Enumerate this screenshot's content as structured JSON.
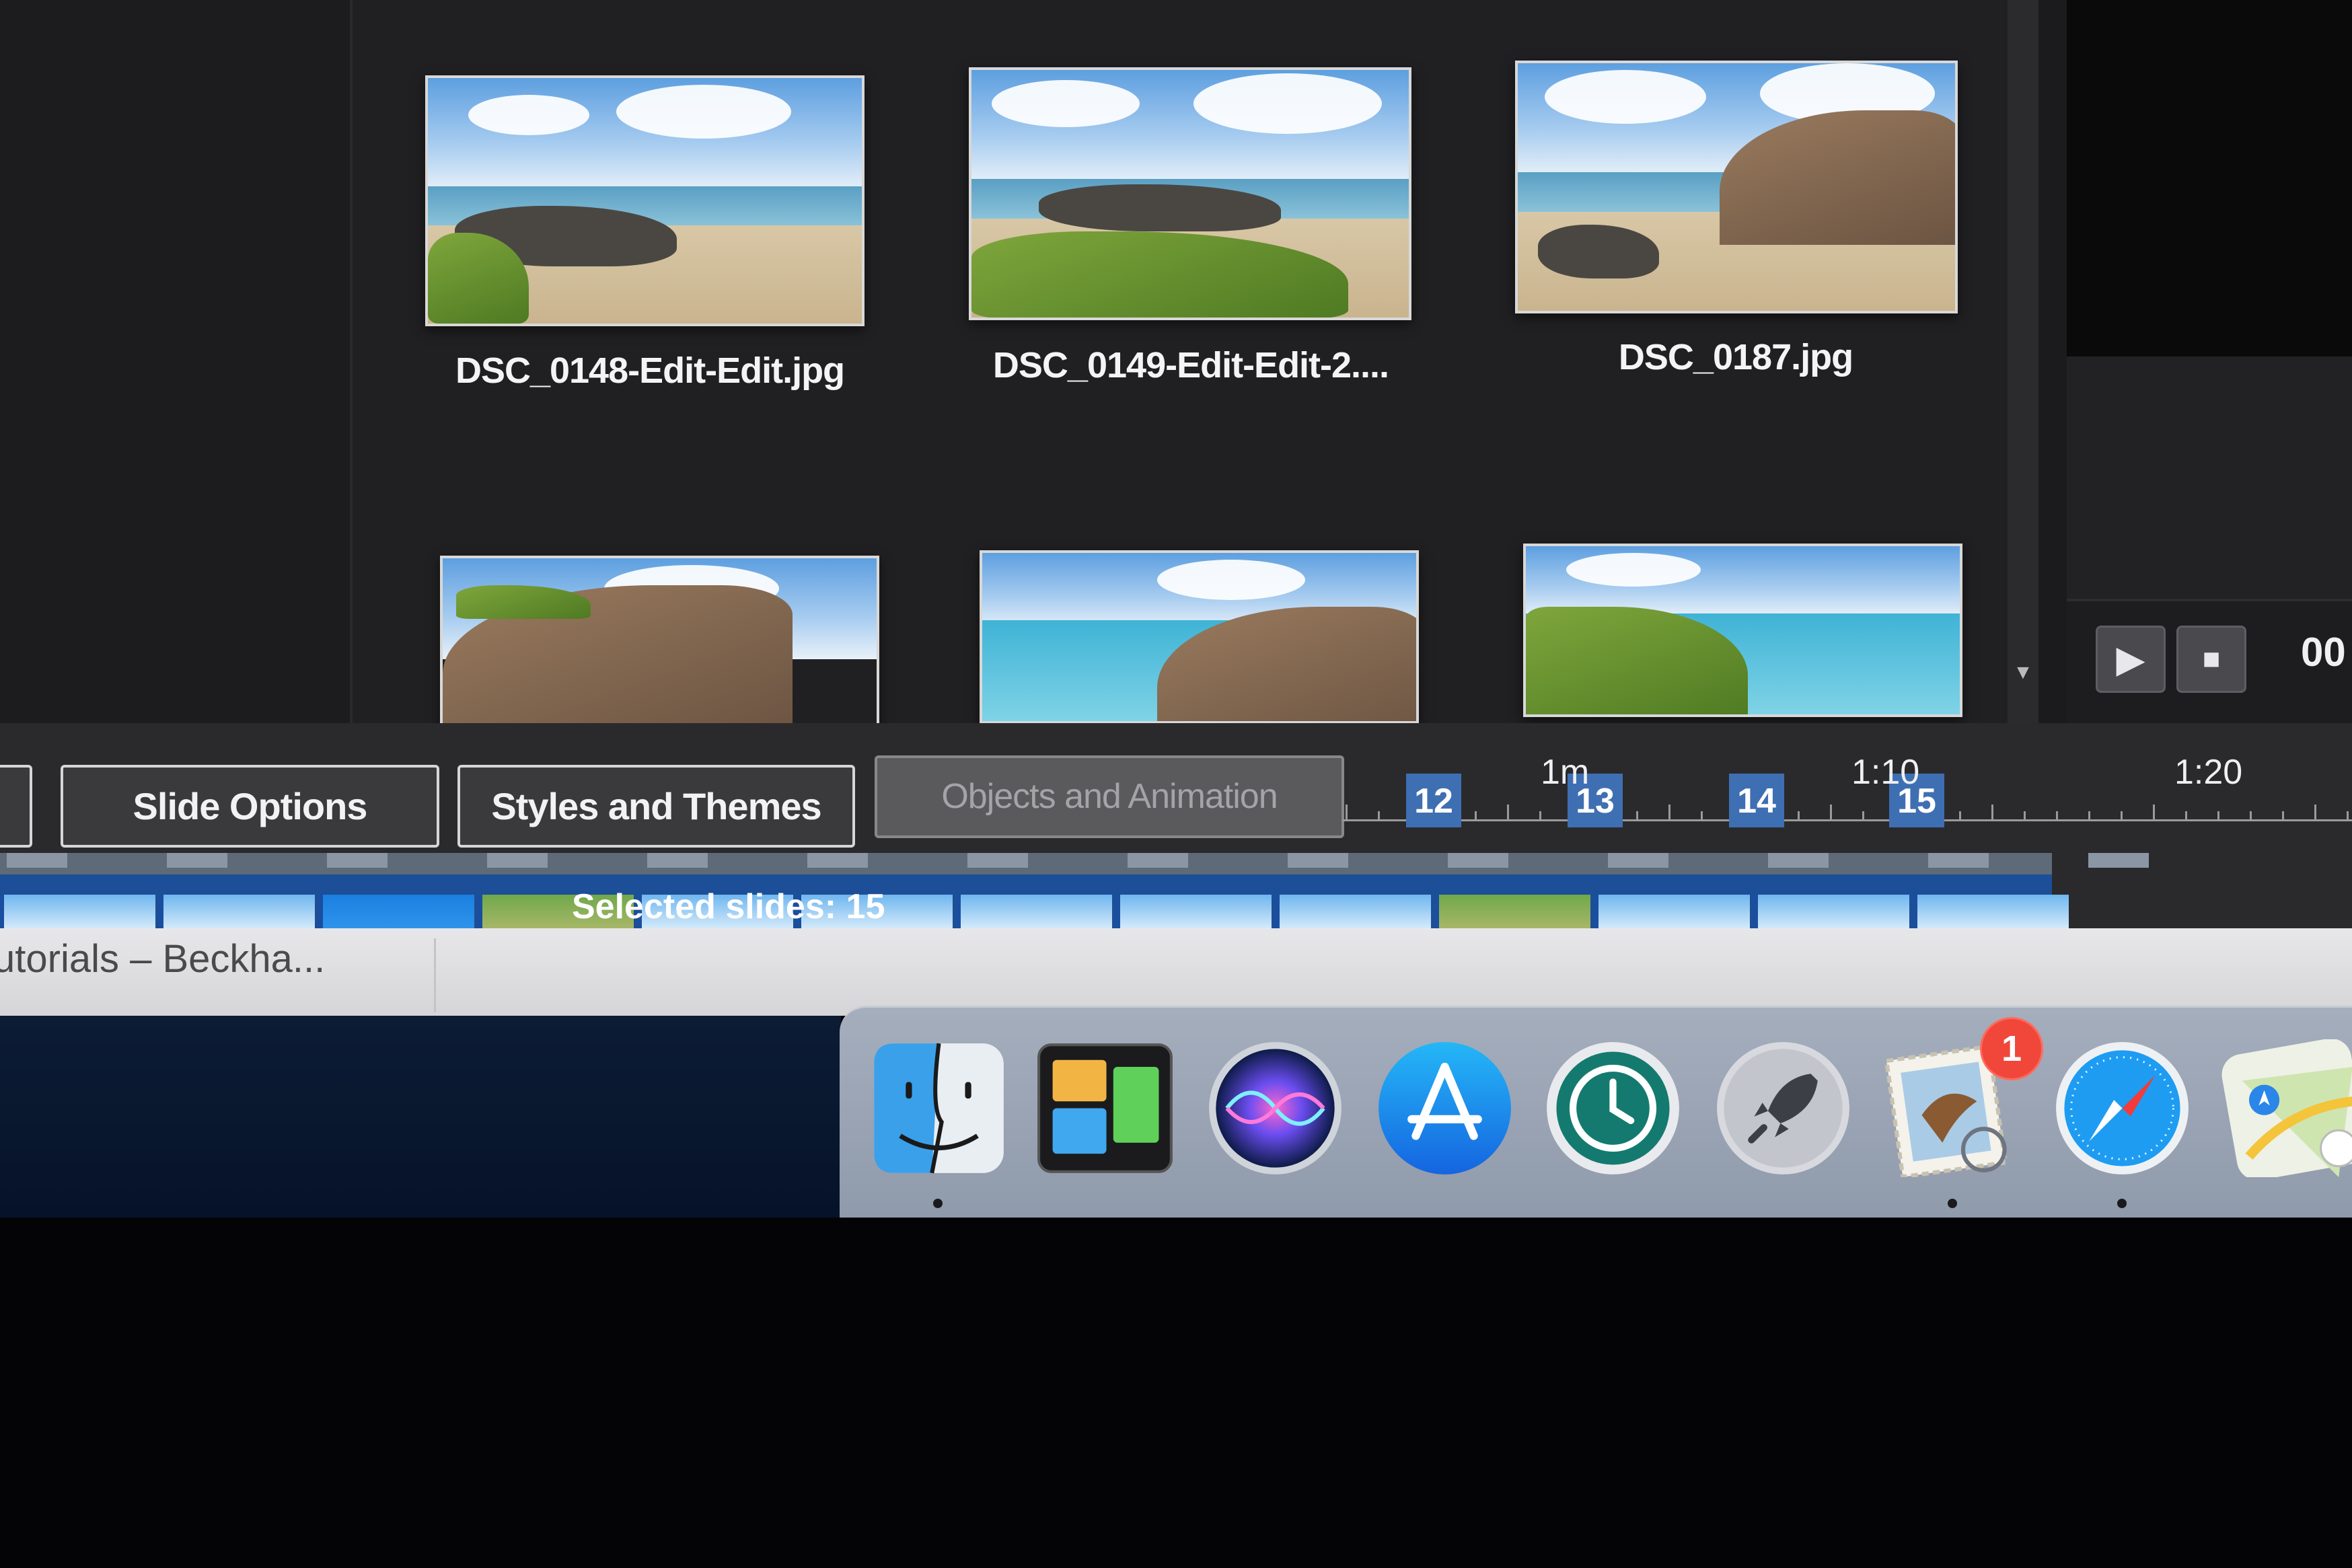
{
  "browser": {
    "photos": [
      {
        "filename": "DSC_0148-Edit-Edit.jpg"
      },
      {
        "filename": "DSC_0149-Edit-Edit-2...."
      },
      {
        "filename": "DSC_0187.jpg"
      },
      {
        "filename": ""
      },
      {
        "filename": ""
      },
      {
        "filename": ""
      }
    ]
  },
  "preview": {
    "time": "00",
    "play_icon": "play-icon",
    "stop_icon": "stop-icon"
  },
  "timeline": {
    "tabs": [
      {
        "label": "Slide Options"
      },
      {
        "label": "Styles and Themes"
      },
      {
        "label": "Objects and Animation"
      }
    ],
    "markers": [
      "12",
      "13",
      "14",
      "15"
    ],
    "time_labels": [
      "1m",
      "1:10",
      "1:20"
    ],
    "selected_slides": "Selected slides: 15"
  },
  "window": {
    "title": "utorials – Beckha..."
  },
  "dock": {
    "items": [
      "Finder",
      "Mission Control",
      "Siri",
      "App Store",
      "Time Machine",
      "Launchpad",
      "Mail",
      "Safari",
      "Maps"
    ],
    "mail_badge": "1"
  },
  "colors": {
    "accent": "#3f6fb3",
    "filmstrip": "#1c4f97",
    "badge": "#f0473a"
  }
}
